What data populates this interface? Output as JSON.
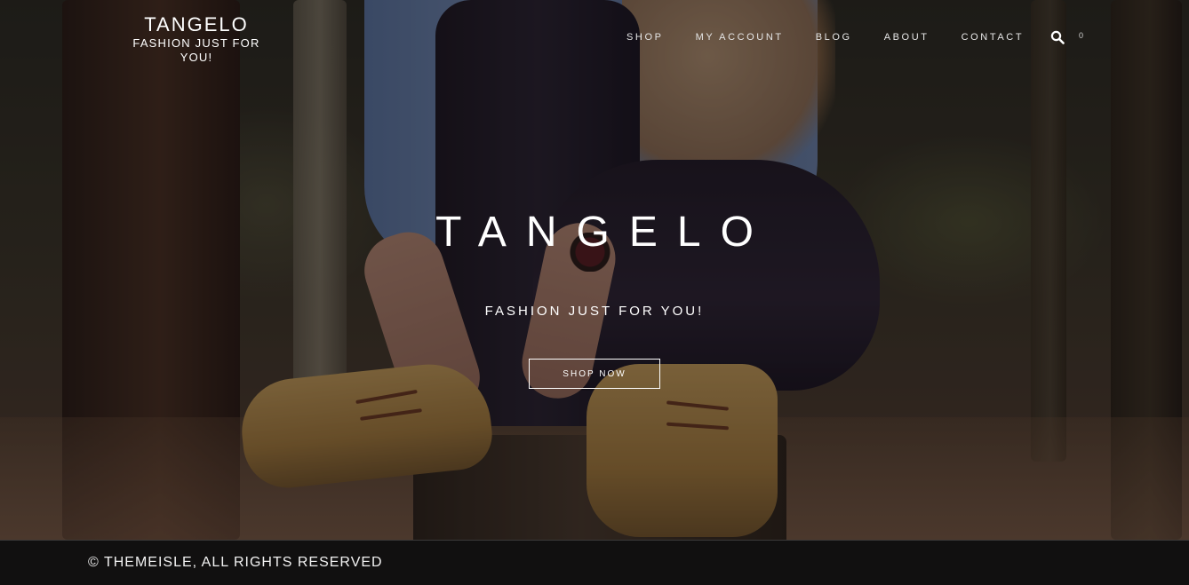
{
  "header": {
    "brand_name": "TANGELO",
    "brand_tagline": "FASHION JUST FOR YOU!",
    "nav": [
      {
        "label": "SHOP"
      },
      {
        "label": "MY ACCOUNT"
      },
      {
        "label": "BLOG"
      },
      {
        "label": "ABOUT"
      },
      {
        "label": "CONTACT"
      }
    ],
    "search_icon": "search-icon",
    "cart_count": "0"
  },
  "hero": {
    "title": "TANGELO",
    "subtitle": "FASHION JUST FOR YOU!",
    "button_label": "SHOP NOW"
  },
  "footer": {
    "copyright": "© THEMEISLE, ALL RIGHTS RESERVED",
    "background": "#111010"
  }
}
